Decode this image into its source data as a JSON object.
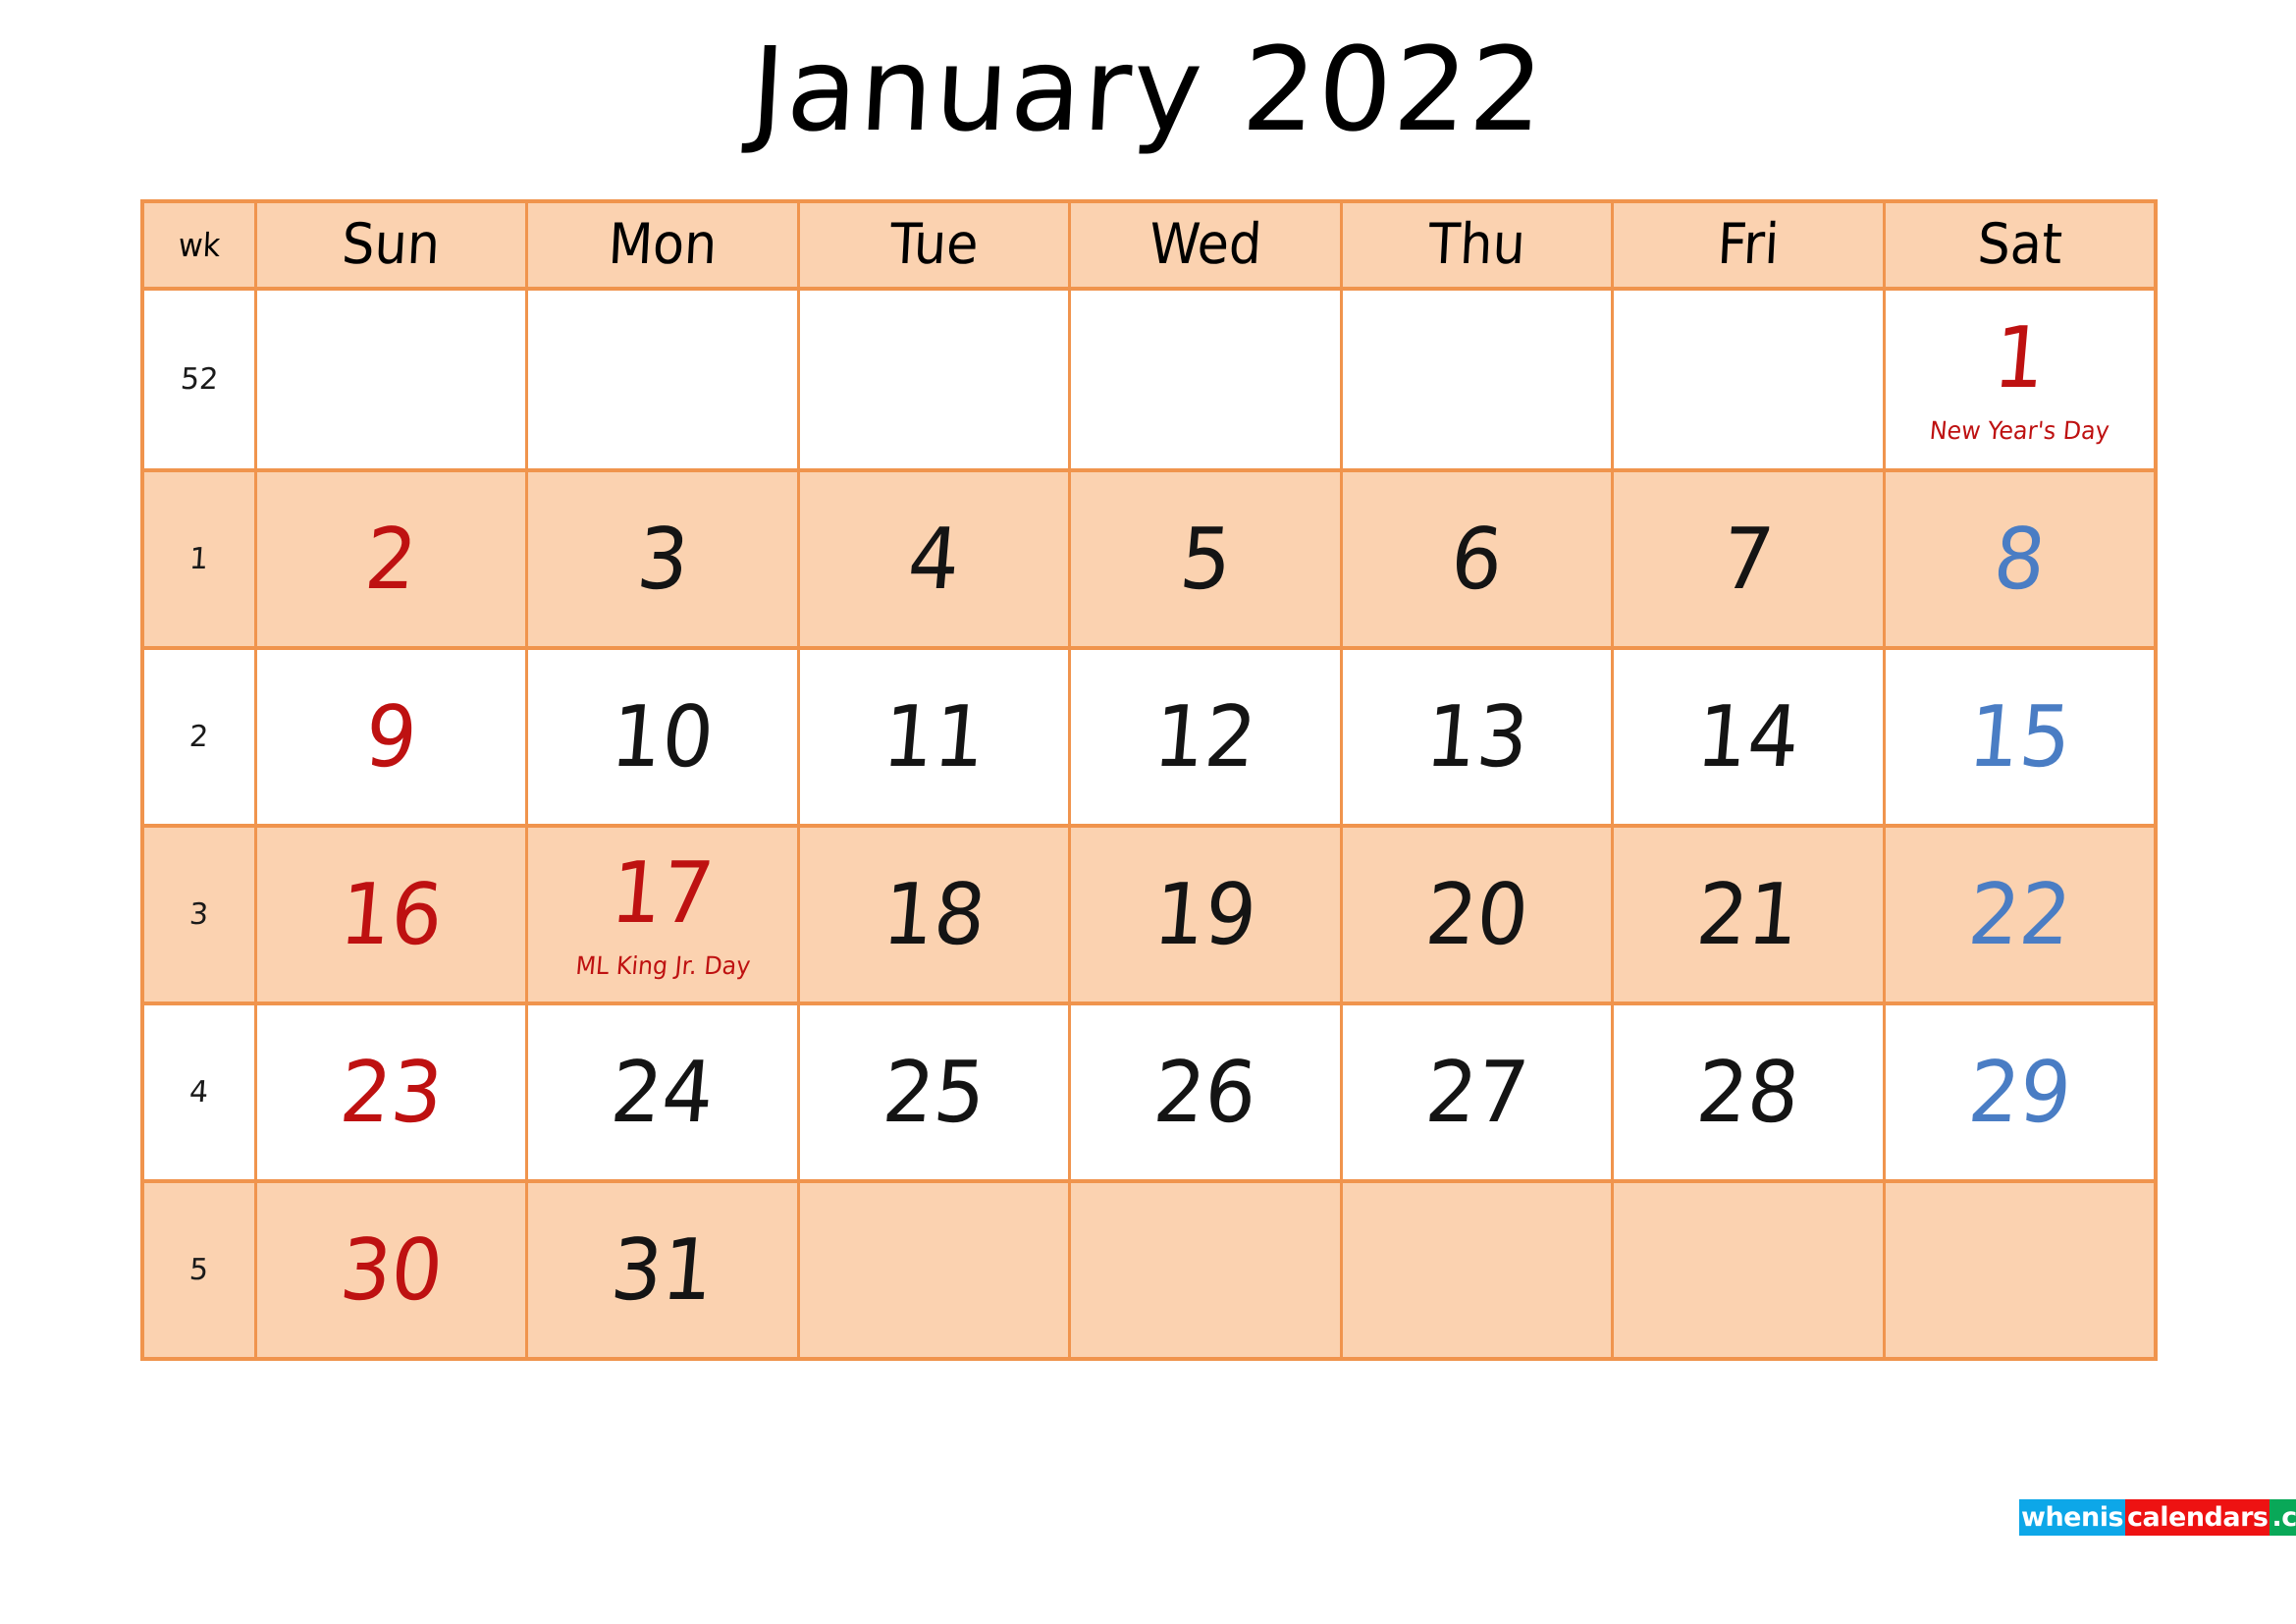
{
  "document": {
    "title": "January 2022",
    "month": "January",
    "year": "2022"
  },
  "colors": {
    "grid_border": "#F0944D",
    "row_shade": "#FBD2B0",
    "sunday_text": "#BE1111",
    "saturday_text": "#4A7DC4",
    "weekday_text": "#141414",
    "holiday_text": "#BE1111",
    "watermark_blue": "#0DA7E8",
    "watermark_red": "#EE1212",
    "watermark_green": "#09A858"
  },
  "header": {
    "week_column_label": "wk",
    "day_names": [
      "Sun",
      "Mon",
      "Tue",
      "Wed",
      "Thu",
      "Fri",
      "Sat"
    ]
  },
  "weeks": [
    {
      "wk": "52",
      "shaded": false,
      "days": [
        {
          "date": "",
          "holiday": ""
        },
        {
          "date": "",
          "holiday": ""
        },
        {
          "date": "",
          "holiday": ""
        },
        {
          "date": "",
          "holiday": ""
        },
        {
          "date": "",
          "holiday": ""
        },
        {
          "date": "",
          "holiday": ""
        },
        {
          "date": "1",
          "holiday": "New Year's Day"
        }
      ]
    },
    {
      "wk": "1",
      "shaded": true,
      "days": [
        {
          "date": "2",
          "holiday": ""
        },
        {
          "date": "3",
          "holiday": ""
        },
        {
          "date": "4",
          "holiday": ""
        },
        {
          "date": "5",
          "holiday": ""
        },
        {
          "date": "6",
          "holiday": ""
        },
        {
          "date": "7",
          "holiday": ""
        },
        {
          "date": "8",
          "holiday": ""
        }
      ]
    },
    {
      "wk": "2",
      "shaded": false,
      "days": [
        {
          "date": "9",
          "holiday": ""
        },
        {
          "date": "10",
          "holiday": ""
        },
        {
          "date": "11",
          "holiday": ""
        },
        {
          "date": "12",
          "holiday": ""
        },
        {
          "date": "13",
          "holiday": ""
        },
        {
          "date": "14",
          "holiday": ""
        },
        {
          "date": "15",
          "holiday": ""
        }
      ]
    },
    {
      "wk": "3",
      "shaded": true,
      "days": [
        {
          "date": "16",
          "holiday": ""
        },
        {
          "date": "17",
          "holiday": "ML King Jr. Day"
        },
        {
          "date": "18",
          "holiday": ""
        },
        {
          "date": "19",
          "holiday": ""
        },
        {
          "date": "20",
          "holiday": ""
        },
        {
          "date": "21",
          "holiday": ""
        },
        {
          "date": "22",
          "holiday": ""
        }
      ]
    },
    {
      "wk": "4",
      "shaded": false,
      "days": [
        {
          "date": "23",
          "holiday": ""
        },
        {
          "date": "24",
          "holiday": ""
        },
        {
          "date": "25",
          "holiday": ""
        },
        {
          "date": "26",
          "holiday": ""
        },
        {
          "date": "27",
          "holiday": ""
        },
        {
          "date": "28",
          "holiday": ""
        },
        {
          "date": "29",
          "holiday": ""
        }
      ]
    },
    {
      "wk": "5",
      "shaded": true,
      "days": [
        {
          "date": "30",
          "holiday": ""
        },
        {
          "date": "31",
          "holiday": ""
        },
        {
          "date": "",
          "holiday": ""
        },
        {
          "date": "",
          "holiday": ""
        },
        {
          "date": "",
          "holiday": ""
        },
        {
          "date": "",
          "holiday": ""
        },
        {
          "date": "",
          "holiday": ""
        }
      ]
    }
  ],
  "watermark": {
    "segment_1": "whenis",
    "segment_2": "calendars",
    "segment_3": ".com"
  }
}
